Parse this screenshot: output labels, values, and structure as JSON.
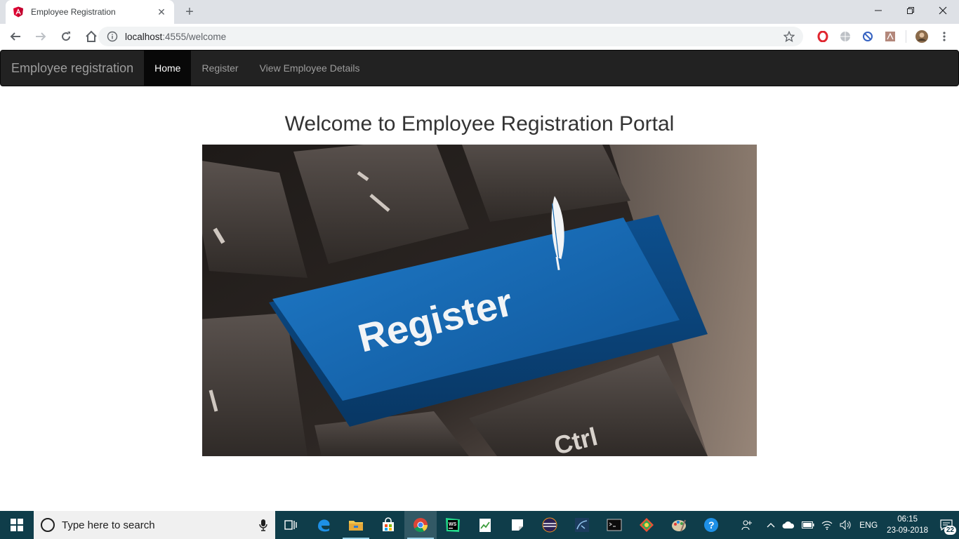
{
  "browser": {
    "tab_title": "Employee Registration",
    "url_host": "localhost",
    "url_rest": ":4555/welcome"
  },
  "navbar": {
    "brand": "Employee registration",
    "items": [
      {
        "label": "Home",
        "active": true
      },
      {
        "label": "Register",
        "active": false
      },
      {
        "label": "View Employee Details",
        "active": false
      }
    ]
  },
  "main": {
    "heading": "Welcome to Employee Registration Portal",
    "hero_key_text": "Register",
    "hero_ctrl_text": "Ctrl"
  },
  "taskbar": {
    "search_placeholder": "Type here to search",
    "apps": [
      "task-view",
      "edge",
      "file-explorer",
      "store",
      "chrome",
      "webstorm",
      "notepad",
      "sticky-notes",
      "eclipse",
      "mysql-workbench",
      "terminal",
      "git",
      "paint",
      "help"
    ],
    "language": "ENG",
    "time": "06:15",
    "date": "23-09-2018",
    "notification_count": "22"
  },
  "colors": {
    "navbar_bg": "#222222",
    "navbar_active": "#080808",
    "key_blue": "#1767b0",
    "taskbar_bg": "#0f3d4a"
  }
}
